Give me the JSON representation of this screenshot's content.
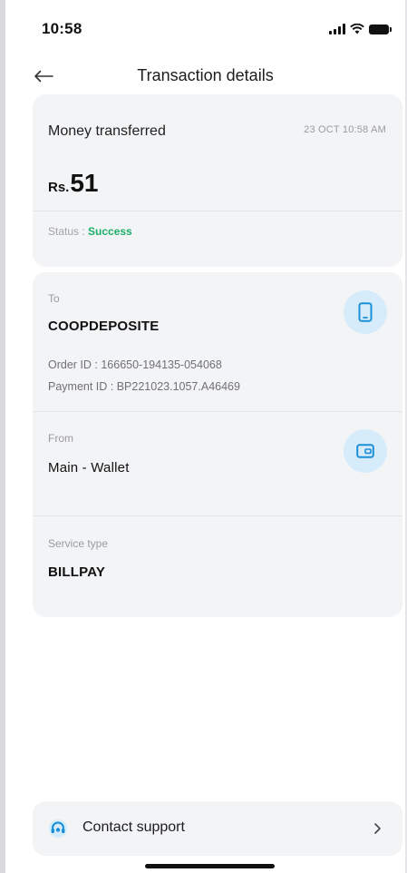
{
  "status_bar": {
    "time": "10:58"
  },
  "header": {
    "title": "Transaction details"
  },
  "summary": {
    "title": "Money transferred",
    "datetime": "23 OCT 10:58 AM",
    "currency": "Rs.",
    "amount": "51",
    "status_prefix": "Status : ",
    "status_value": "Success",
    "status_color": "#1fae6a"
  },
  "details": {
    "to": {
      "label": "To",
      "name": "COOPDEPOSITE",
      "order_id": "Order ID : 166650-194135-054068",
      "payment_id": "Payment ID : BP221023.1057.A46469",
      "icon": "phone-icon"
    },
    "from": {
      "label": "From",
      "name": "Main - Wallet",
      "icon": "wallet-icon"
    },
    "service": {
      "label": "Service type",
      "value": "BILLPAY"
    }
  },
  "support": {
    "label": "Contact support",
    "icon": "headset-icon"
  },
  "colors": {
    "accent": "#1b8fd6",
    "icon_bg": "#d6ecfb",
    "card_bg": "#f3f4f6"
  }
}
